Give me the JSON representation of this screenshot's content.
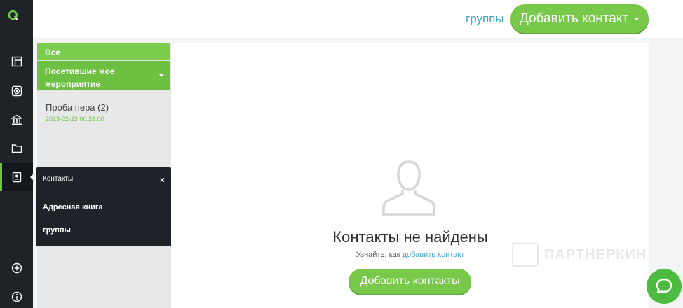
{
  "header": {
    "groups_link": "группы",
    "add_contact_button": "Добавить контакт"
  },
  "sidebar": {
    "all": "Все",
    "visited": "Посетившие мое мероприятие",
    "entry": {
      "title": "Проба пера (2)",
      "date": "2023-02-23 00:28:00"
    }
  },
  "popup": {
    "title": "Контакты",
    "close": "×",
    "items": [
      "Адресная книга",
      "группы"
    ]
  },
  "empty_state": {
    "title": "Контакты не найдены",
    "hint_prefix": "Узнайте, как",
    "hint_link": "добавить контакт",
    "button": "Добавить контакты"
  },
  "watermark": {
    "text": "ПАРТНЕРКИН"
  },
  "colors": {
    "accent_green": "#78c84a",
    "link_blue": "#3fa7c9",
    "rail_dark": "#1f2328"
  }
}
